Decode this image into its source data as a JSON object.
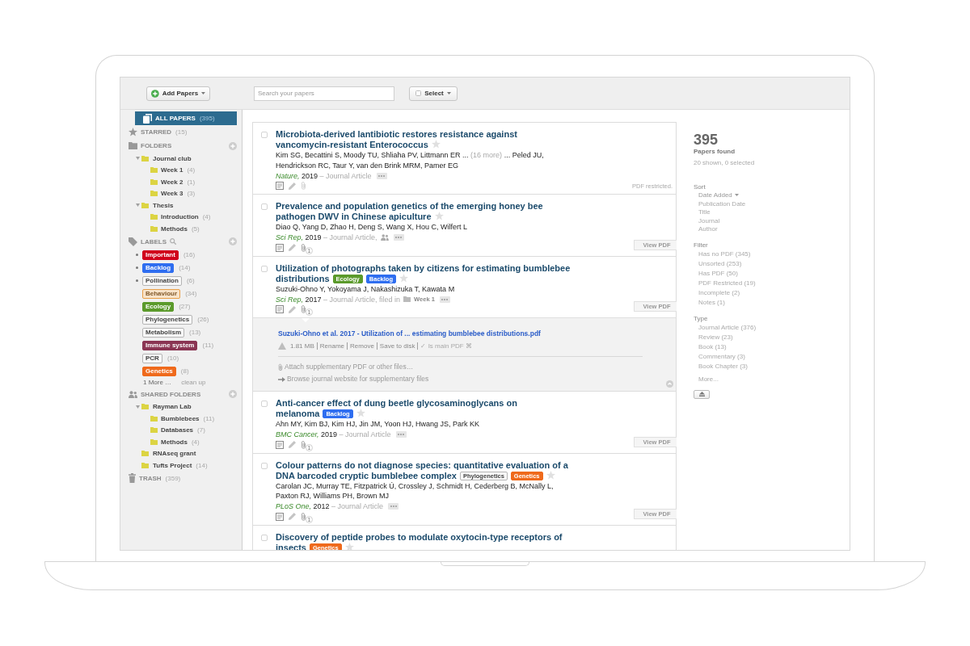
{
  "toolbar": {
    "add_button": "Add Papers",
    "search": {
      "placeholder": "Search your papers"
    },
    "select_button": "Select"
  },
  "sidebar": [
    {
      "kind": "all",
      "label": "ALL PAPERS",
      "count": "(395)",
      "selected": true
    },
    {
      "kind": "starred",
      "label": "STARRED",
      "count": "(15)",
      "selected": false
    },
    {
      "kind": "folders",
      "label": "FOLDERS",
      "selected": false,
      "folders": [
        {
          "name": "Journal club",
          "expanded": true,
          "children": [
            {
              "name": "Week 1",
              "count": "(4)"
            },
            {
              "name": "Week 2",
              "count": "(1)"
            },
            {
              "name": "Week 3",
              "count": "(3)"
            }
          ]
        },
        {
          "name": "Thesis",
          "expanded": true,
          "children": [
            {
              "name": "Introduction",
              "count": "(4)"
            },
            {
              "name": "Methods",
              "count": "(5)"
            }
          ]
        }
      ]
    },
    {
      "kind": "labels",
      "label": "LABELS",
      "selected": false,
      "labels": [
        {
          "name": "Important",
          "count": "(16)",
          "kind": "solid",
          "color": "#d0021b",
          "marked": true
        },
        {
          "name": "Backlog",
          "count": "(14)",
          "kind": "solid",
          "color": "#2f6ef0",
          "marked": true
        },
        {
          "name": "Pollination",
          "count": "(6)",
          "kind": "outline",
          "color": "#b5b5b5",
          "marked": true
        },
        {
          "name": "Behaviour",
          "count": "(34)",
          "kind": "tint",
          "color": "#e8a04a",
          "marked": false
        },
        {
          "name": "Ecology",
          "count": "(27)",
          "kind": "solid",
          "color": "#5b9a2b",
          "marked": false
        },
        {
          "name": "Phylogenetics",
          "count": "(26)",
          "kind": "outline",
          "color": "#b5b5b5",
          "marked": false
        },
        {
          "name": "Metabolism",
          "count": "(13)",
          "kind": "outline",
          "color": "#b5b5b5",
          "marked": false
        },
        {
          "name": "Immune system",
          "count": "(11)",
          "kind": "solid",
          "color": "#8a3553",
          "marked": false
        },
        {
          "name": "PCR",
          "count": "(10)",
          "kind": "outline",
          "color": "#b5b5b5",
          "marked": false
        },
        {
          "name": "Genetics",
          "count": "(8)",
          "kind": "solid",
          "color": "#ef6a1c",
          "marked": false
        }
      ],
      "more": "1 More …",
      "cleanup": "clean up"
    },
    {
      "kind": "shared",
      "label": "SHARED FOLDERS",
      "selected": false,
      "folders": [
        {
          "name": "Rayman Lab",
          "expanded": true,
          "children": [
            {
              "name": "Bumblebees",
              "count": "(11)"
            },
            {
              "name": "Databases",
              "count": "(7)"
            },
            {
              "name": "Methods",
              "count": "(4)"
            }
          ]
        },
        {
          "name": "RNAseq grant"
        },
        {
          "name": "Tufts Project",
          "count": "(14)"
        }
      ]
    },
    {
      "kind": "trash",
      "label": "TRASH",
      "count": "(359)",
      "selected": false
    }
  ],
  "papers": [
    {
      "checked": false,
      "title": "Microbiota-derived lantibiotic restores resistance against vancomycin-resistant Enterococcus",
      "starred": false,
      "authors": "Kim SG, Becattini S, Moody TU, Shliaha PV, Littmann ER ...",
      "authors_more": "(16 more)",
      "authors_rest": "... Peled JU, Hendrickson RC, Taur Y, van den Brink MRM, Pamer EG",
      "journal": "Nature,",
      "year": "2019",
      "type": "– Journal Article",
      "shared": false,
      "pdf": {
        "kind": "status",
        "text": "PDF restricted."
      }
    },
    {
      "checked": false,
      "title": "Prevalence and population genetics of the emerging honey bee pathogen DWV in Chinese apiculture",
      "starred": false,
      "authors": "Diao Q, Yang D, Zhao H, Deng S, Wang X, Hou C, Wilfert L",
      "journal": "Sci Rep,",
      "year": "2019",
      "type": "– Journal Article,",
      "shared": true,
      "attachments": "1",
      "pdf": {
        "kind": "button",
        "text": "View PDF"
      }
    },
    {
      "checked": false,
      "title": "Utilization of photographs taken by citizens for estimating bumblebee distributions",
      "labels": [
        {
          "name": "Ecology",
          "kind": "solid",
          "color": "#5b9a2b"
        },
        {
          "name": "Backlog",
          "kind": "solid",
          "color": "#2f6ef0"
        }
      ],
      "starred": false,
      "authors": "Suzuki-Ohno Y, Yokoyama J, Nakashizuka T, Kawata M",
      "journal": "Sci Rep,",
      "year": "2017",
      "type": "– Journal Article, filed in",
      "folder": "Week 1",
      "shared": false,
      "attachments": "1",
      "pdf": {
        "kind": "button",
        "text": "View PDF"
      },
      "attachment_panel": {
        "file": "Suzuki-Ohno et al. 2017 - Utilization of ... estimating bumblebee distributions.pdf",
        "details": [
          {
            "kind": "size",
            "text": "1.81 MB"
          },
          {
            "kind": "action",
            "text": "Rename"
          },
          {
            "kind": "action",
            "text": "Remove"
          },
          {
            "kind": "action",
            "text": "Save to disk"
          },
          {
            "kind": "option",
            "text": "✓ Is main PDF ⌘"
          }
        ],
        "attach": "Attach supplementary PDF or other files…",
        "browse": "Browse journal website for supplementary files"
      }
    },
    {
      "checked": false,
      "title": "Anti-cancer effect of dung beetle glycosaminoglycans on melanoma",
      "labels": [
        {
          "name": "Backlog",
          "kind": "solid",
          "color": "#2f6ef0"
        }
      ],
      "starred": false,
      "authors": "Ahn MY, Kim BJ, Kim HJ, Jin JM, Yoon HJ, Hwang JS, Park KK",
      "journal": "BMC Cancer,",
      "year": "2019",
      "type": "– Journal Article",
      "shared": false,
      "attachments": "1",
      "pdf": {
        "kind": "button",
        "text": "View PDF"
      }
    },
    {
      "checked": false,
      "title": "Colour patterns do not diagnose species: quantitative evaluation of a DNA barcoded cryptic bumblebee complex",
      "labels": [
        {
          "name": "Phylogenetics",
          "kind": "outline",
          "color": "#b5b5b5"
        },
        {
          "name": "Genetics",
          "kind": "solid",
          "color": "#ef6a1c"
        }
      ],
      "starred": false,
      "authors": "Carolan JC, Murray TE, Fitzpatrick Ú, Crossley J, Schmidt H, Cederberg B, McNally L, Paxton RJ, Williams PH, Brown MJ",
      "journal": "PLoS One,",
      "year": "2012",
      "type": "– Journal Article",
      "shared": false,
      "attachments": "1",
      "pdf": {
        "kind": "button",
        "text": "View PDF"
      }
    },
    {
      "checked": false,
      "title": "Discovery of peptide probes to modulate oxytocin-type receptors of insects",
      "labels": [
        {
          "name": "Genetics",
          "kind": "solid",
          "color": "#ef6a1c"
        }
      ],
      "starred": false
    }
  ],
  "summary": {
    "count": "395",
    "caption": "Papers found",
    "status": "20 shown, 0 selected"
  },
  "sort": {
    "title": "Sort",
    "options": [
      {
        "label": "Date Added",
        "selected": true
      },
      {
        "label": "Publication Date",
        "selected": false
      },
      {
        "label": "Title",
        "selected": false
      },
      {
        "label": "Journal",
        "selected": false
      },
      {
        "label": "Author",
        "selected": false
      }
    ]
  },
  "filter": {
    "title": "Filter",
    "options": [
      "Has no PDF (345)",
      "Unsorted (253)",
      "Has PDF (50)",
      "PDF Restricted (19)",
      "Incomplete (2)",
      "Notes (1)"
    ]
  },
  "type": {
    "title": "Type",
    "options": [
      "Journal Article (376)",
      "Review (23)",
      "Book (13)",
      "Commentary (3)",
      "Book Chapter (3)"
    ],
    "more": "More..."
  }
}
